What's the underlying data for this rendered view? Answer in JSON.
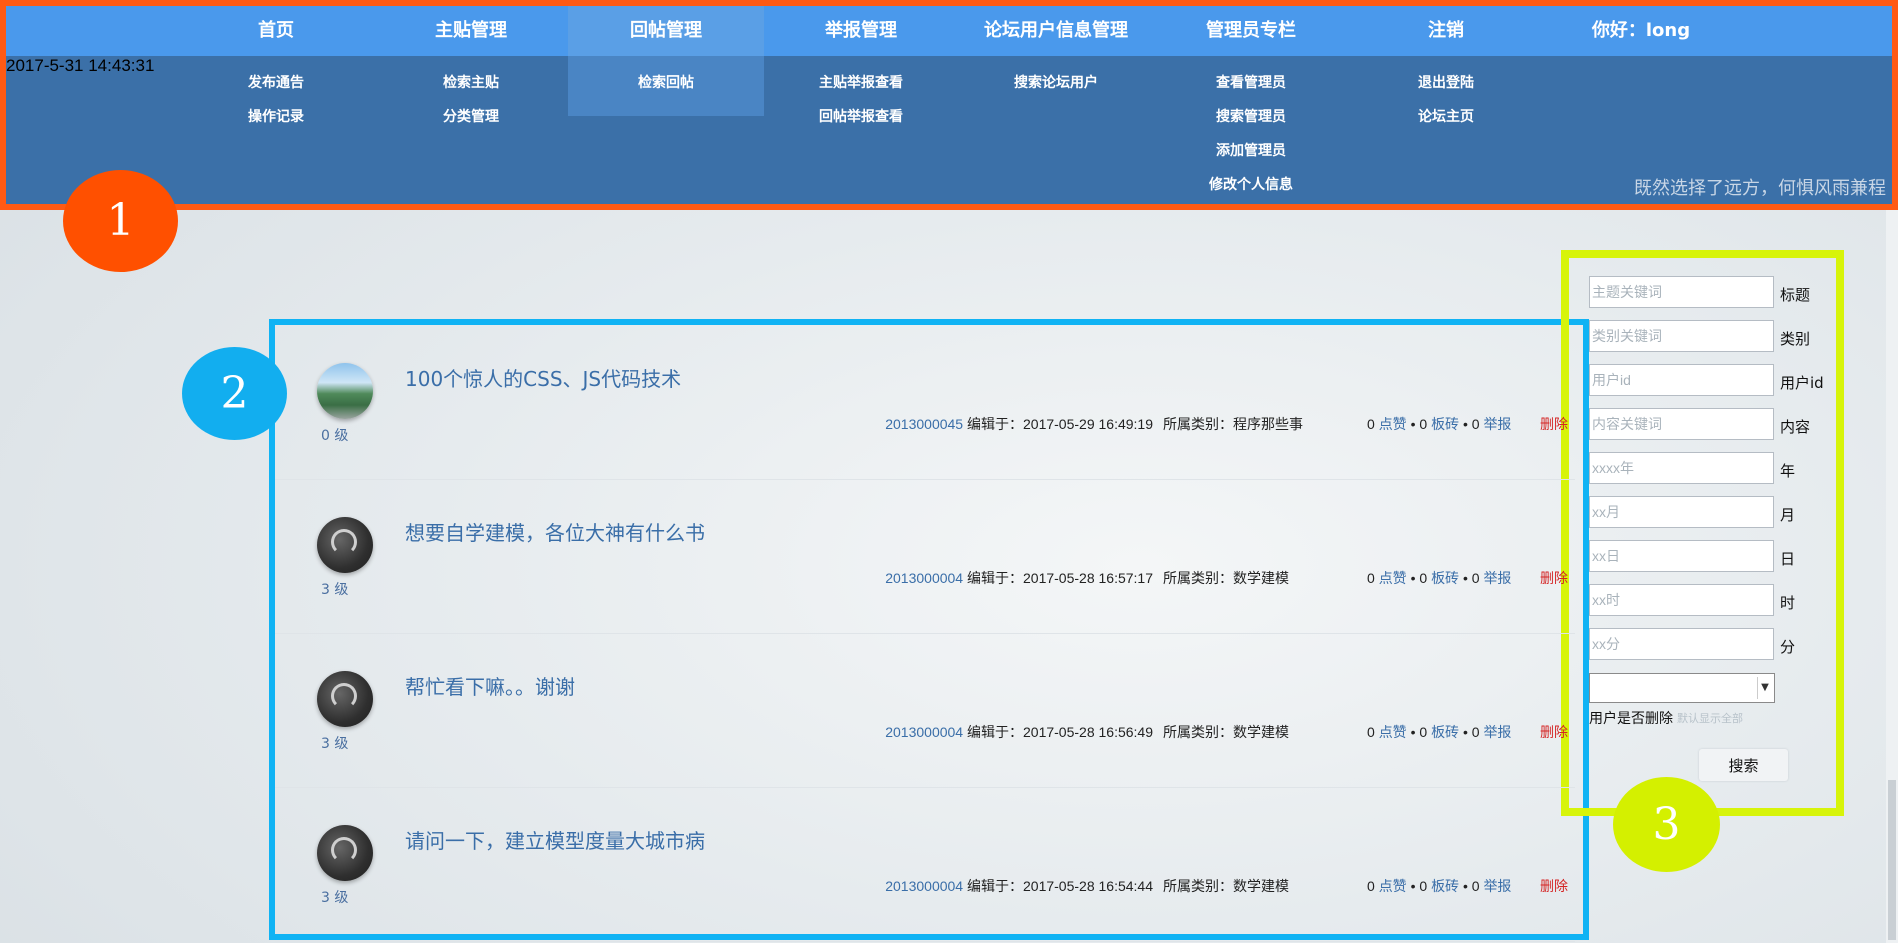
{
  "header": {
    "clock": "2017-5-31 14:43:31",
    "greeting": "你好：long",
    "motto": "既然选择了远方，何惧风雨兼程",
    "nav": [
      {
        "label": "首页",
        "sub": [
          "发布通告",
          "操作记录"
        ]
      },
      {
        "label": "主贴管理",
        "sub": [
          "检索主贴",
          "分类管理"
        ]
      },
      {
        "label": "回帖管理",
        "sub": [
          "检索回帖"
        ],
        "active": true
      },
      {
        "label": "举报管理",
        "sub": [
          "主贴举报查看",
          "回帖举报查看"
        ]
      },
      {
        "label": "论坛用户信息管理",
        "sub": [
          "搜索论坛用户"
        ]
      },
      {
        "label": "管理员专栏",
        "sub": [
          "查看管理员",
          "搜索管理员",
          "添加管理员",
          "修改个人信息"
        ]
      },
      {
        "label": "注销",
        "sub": [
          "退出登陆",
          "论坛主页"
        ]
      }
    ]
  },
  "markers": [
    "1",
    "2",
    "3"
  ],
  "posts": [
    {
      "title": "100个惊人的CSS、JS代码技术",
      "level": "0 级",
      "uid": "2013000045",
      "edited": "编辑于：2017-05-29 16:49:19",
      "category": "所属类别：程序那些事",
      "likes": "0",
      "like_label": "点赞",
      "bricks": "0",
      "brick_label": "板砖",
      "reports": "0",
      "report_label": "举报",
      "delete": "删除",
      "avatar": "photo"
    },
    {
      "title": "想要自学建模，各位大神有什么书",
      "level": "3 级",
      "uid": "2013000004",
      "edited": "编辑于：2017-05-28 16:57:17",
      "category": "所属类别：数学建模",
      "likes": "0",
      "like_label": "点赞",
      "bricks": "0",
      "brick_label": "板砖",
      "reports": "0",
      "report_label": "举报",
      "delete": "删除",
      "avatar": "default"
    },
    {
      "title": "帮忙看下嘛。。谢谢",
      "level": "3 级",
      "uid": "2013000004",
      "edited": "编辑于：2017-05-28 16:56:49",
      "category": "所属类别：数学建模",
      "likes": "0",
      "like_label": "点赞",
      "bricks": "0",
      "brick_label": "板砖",
      "reports": "0",
      "report_label": "举报",
      "delete": "删除",
      "avatar": "default"
    },
    {
      "title": "请问一下，建立模型度量大城市病",
      "level": "3 级",
      "uid": "2013000004",
      "edited": "编辑于：2017-05-28 16:54:44",
      "category": "所属类别：数学建模",
      "likes": "0",
      "like_label": "点赞",
      "bricks": "0",
      "brick_label": "板砖",
      "reports": "0",
      "report_label": "举报",
      "delete": "删除",
      "avatar": "default"
    }
  ],
  "search": {
    "fields": [
      {
        "placeholder": "主题关键词",
        "label": "标题"
      },
      {
        "placeholder": "类别关键词",
        "label": "类别"
      },
      {
        "placeholder": "用户id",
        "label": "用户id"
      },
      {
        "placeholder": "内容关键词",
        "label": "内容"
      },
      {
        "placeholder": "xxxx年",
        "label": "年"
      },
      {
        "placeholder": "xx月",
        "label": "月"
      },
      {
        "placeholder": "xx日",
        "label": "日"
      },
      {
        "placeholder": "xx时",
        "label": "时"
      },
      {
        "placeholder": "xx分",
        "label": "分"
      }
    ],
    "select_value": "",
    "delete_label": "用户是否删除",
    "delete_hint": "默认显示全部",
    "button": "搜索"
  },
  "colors": {
    "accent": "#4a99ec",
    "header_bg": "#3b70a8",
    "marker1": "#ff5000",
    "marker2": "#12aeef",
    "marker3": "#d4f000",
    "link": "#3a6ea8",
    "danger": "#d42424"
  }
}
